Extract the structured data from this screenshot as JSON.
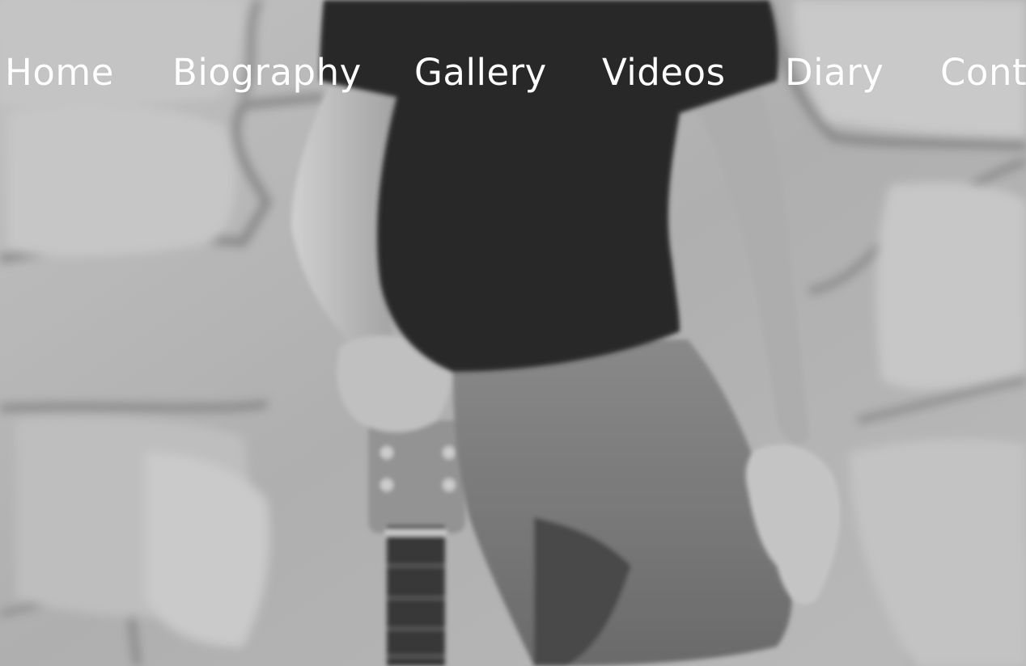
{
  "nav": {
    "items": [
      {
        "label": "Home"
      },
      {
        "label": "Biography"
      },
      {
        "label": "Gallery"
      },
      {
        "label": "Videos"
      },
      {
        "label": "Diary"
      },
      {
        "label": "Contact"
      }
    ],
    "text_color": "#ffffff"
  },
  "hero": {
    "image_subject": "guitarist-seated-against-stone-wall",
    "tone": "grayscale"
  }
}
